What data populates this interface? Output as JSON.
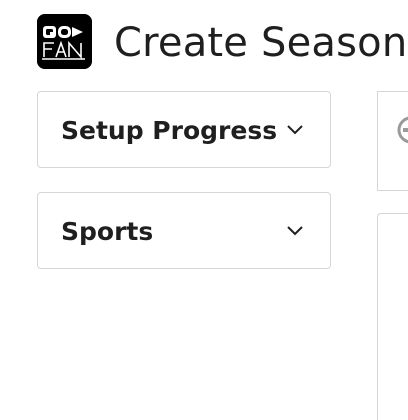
{
  "header": {
    "title": "Create Season",
    "logo_alt": "GO FAN"
  },
  "sidebar": {
    "sections": [
      {
        "label": "Setup Progress",
        "icon": "chevron-down-icon",
        "expanded": false
      },
      {
        "label": "Sports",
        "icon": "chevron-down-icon",
        "expanded": false
      }
    ]
  },
  "colors": {
    "text": "#1f1f1f",
    "border": "#d6d6d6",
    "logo_bg": "#000000"
  }
}
